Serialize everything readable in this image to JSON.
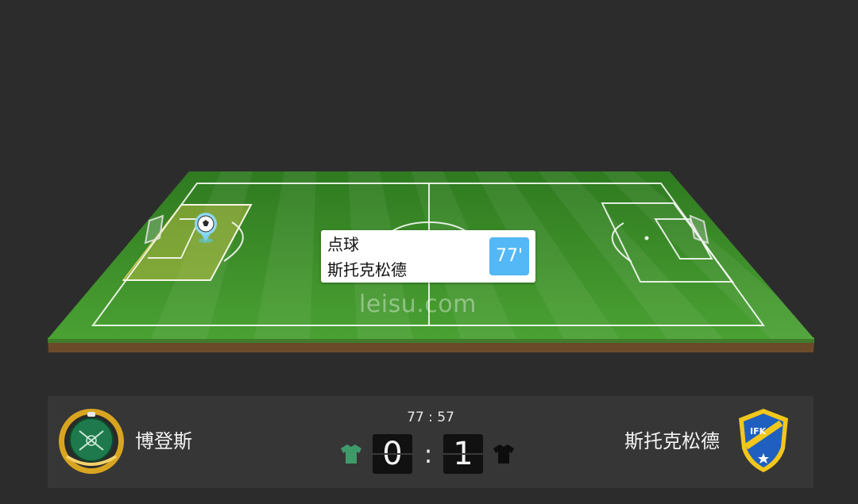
{
  "match": {
    "watermark": "leisu.com",
    "event": {
      "type": "点球",
      "team": "斯托克松德",
      "minute": "77'"
    },
    "clock": "77 : 57",
    "score_separator": ":",
    "home": {
      "name": "博登斯",
      "score": "0",
      "jersey_color": "#3f9a6a",
      "logo_colors": [
        "#1e7a4c",
        "#d9a521"
      ]
    },
    "away": {
      "name": "斯托克松德",
      "score": "1",
      "jersey_color": "#0d0d0d",
      "logo_colors": [
        "#1f5fbf",
        "#f2c71b"
      ]
    }
  },
  "colors": {
    "background": "#2c2c2d",
    "score_bar": "#363637",
    "pitch_green": "#3b8f2a",
    "penalty_highlight": "#d8c74a",
    "minute_badge": "#53b8f5"
  }
}
